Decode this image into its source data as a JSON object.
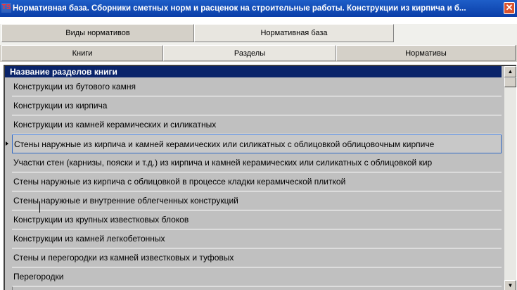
{
  "window": {
    "title": "Нормативная база. Сборники сметных норм и расценок на строительные работы. Конструкции из кирпича и б...",
    "icon_text": "TS",
    "close_glyph": "✕"
  },
  "tabs_top": [
    {
      "label": "Виды нормативов",
      "selected": false
    },
    {
      "label": "Нормативная база",
      "selected": true
    }
  ],
  "tabs_sub": [
    {
      "label": "Книги",
      "selected": false
    },
    {
      "label": "Разделы",
      "selected": true
    },
    {
      "label": "Нормативы",
      "selected": false
    }
  ],
  "grid": {
    "header": "Название разделов книги",
    "current_row_index": 3,
    "rows": [
      "Конструкции из бутового камня",
      "Конструкции из кирпича",
      "Конструкции из камней керамических и силикатных",
      "Стены наружные из кирпича и камней керамических или силикатных с облицовкой облицовочным кирпиче",
      "Участки стен (карнизы, пояски и т.д.) из кирпича и камней керамических или силикатных с облицовкой кир",
      "Стены наружные из кирпича с облицовкой в процессе кладки керамической плиткой",
      "Стены наружные и внутренние облегченных конструкций",
      "Конструкции из крупных известковых блоков",
      "Конструкции из камней легкобетонных",
      "Стены и перегородки из камней известковых и туфовых",
      "Перегородки"
    ]
  },
  "scrollbar": {
    "up_glyph": "▲",
    "down_glyph": "▼"
  },
  "colors": {
    "titlebar": "#0a3ea8",
    "header_row": "#0a246a",
    "row_bg": "#c0c0c0",
    "selection_border": "#316ac5"
  }
}
